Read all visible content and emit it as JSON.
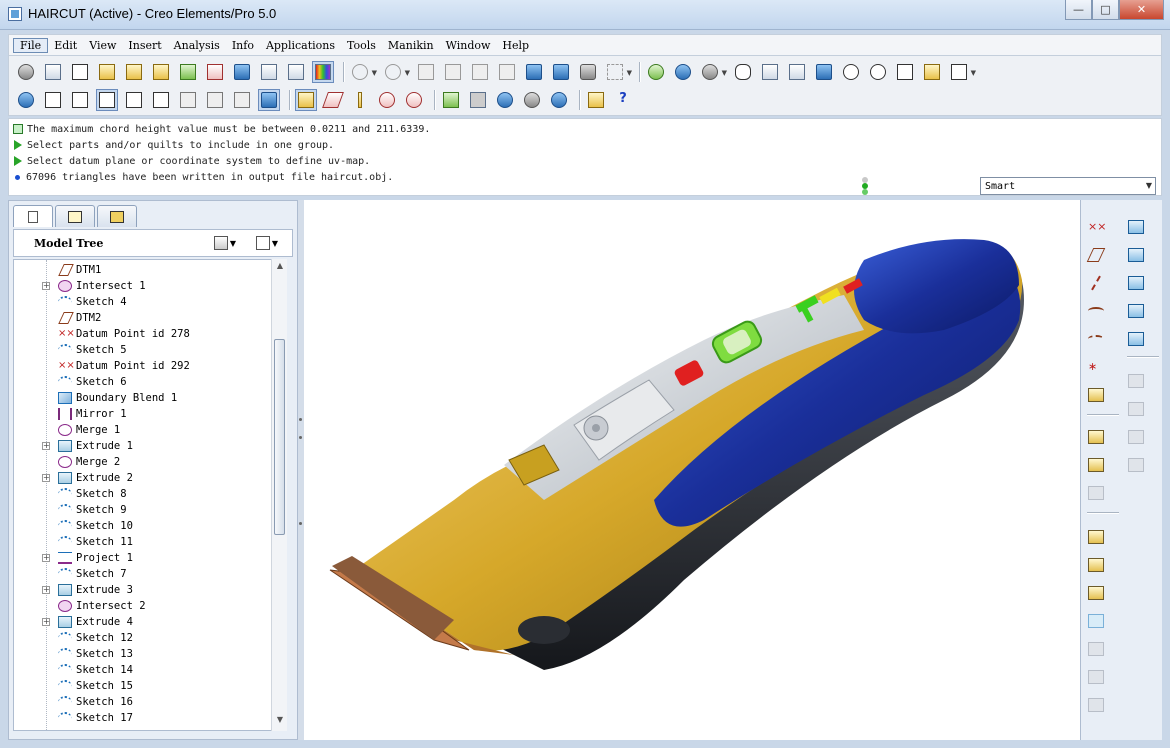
{
  "window": {
    "title": "HAIRCUT (Active) - Creo Elements/Pro 5.0",
    "buttons": [
      "minimize",
      "maximize",
      "close"
    ]
  },
  "menu": [
    "File",
    "Edit",
    "View",
    "Insert",
    "Analysis",
    "Info",
    "Applications",
    "Tools",
    "Manikin",
    "Window",
    "Help"
  ],
  "messages": [
    {
      "icon": "info-doc-icon",
      "text": "The maximum chord height value must be between 0.0211 and 211.6339."
    },
    {
      "icon": "prompt-arrow-icon",
      "text": "Select parts and/or quilts to include in one group."
    },
    {
      "icon": "prompt-arrow-icon",
      "text": "Select datum plane or coordinate system to define uv-map."
    },
    {
      "icon": "bullet-icon",
      "text": "67096 triangles have been written in output file haircut.obj."
    }
  ],
  "filter": {
    "value": "Smart"
  },
  "navigator": {
    "tabs": [
      "model-tree-tab-icon",
      "layers-tab-icon",
      "favorites-tab-icon"
    ],
    "header": "Model Tree"
  },
  "model_tree": [
    {
      "label": "DTM1",
      "type": "datum",
      "expandable": false
    },
    {
      "label": "Intersect 1",
      "type": "intersect",
      "expandable": true
    },
    {
      "label": "Sketch 4",
      "type": "sketch",
      "expandable": false
    },
    {
      "label": "DTM2",
      "type": "datum",
      "expandable": false
    },
    {
      "label": "Datum Point id 278",
      "type": "point",
      "expandable": false
    },
    {
      "label": "Sketch 5",
      "type": "sketch",
      "expandable": false
    },
    {
      "label": "Datum Point id 292",
      "type": "point",
      "expandable": false
    },
    {
      "label": "Sketch 6",
      "type": "sketch",
      "expandable": false
    },
    {
      "label": "Boundary Blend 1",
      "type": "blend",
      "expandable": false
    },
    {
      "label": "Mirror 1",
      "type": "mirror",
      "expandable": false
    },
    {
      "label": "Merge 1",
      "type": "merge",
      "expandable": false
    },
    {
      "label": "Extrude 1",
      "type": "extrude",
      "expandable": true
    },
    {
      "label": "Merge 2",
      "type": "merge",
      "expandable": false
    },
    {
      "label": "Extrude 2",
      "type": "extrude",
      "expandable": true
    },
    {
      "label": "Sketch 8",
      "type": "sketch",
      "expandable": false
    },
    {
      "label": "Sketch 9",
      "type": "sketch",
      "expandable": false
    },
    {
      "label": "Sketch 10",
      "type": "sketch",
      "expandable": false
    },
    {
      "label": "Sketch 11",
      "type": "sketch",
      "expandable": false
    },
    {
      "label": "Project 1",
      "type": "project",
      "expandable": true
    },
    {
      "label": "Sketch 7",
      "type": "sketch",
      "expandable": false
    },
    {
      "label": "Extrude 3",
      "type": "extrude",
      "expandable": true
    },
    {
      "label": "Intersect 2",
      "type": "intersect",
      "expandable": false
    },
    {
      "label": "Extrude 4",
      "type": "extrude",
      "expandable": true
    },
    {
      "label": "Sketch 12",
      "type": "sketch",
      "expandable": false
    },
    {
      "label": "Sketch 13",
      "type": "sketch",
      "expandable": false
    },
    {
      "label": "Sketch 14",
      "type": "sketch",
      "expandable": false
    },
    {
      "label": "Sketch 15",
      "type": "sketch",
      "expandable": false
    },
    {
      "label": "Sketch 16",
      "type": "sketch",
      "expandable": false
    },
    {
      "label": "Sketch 17",
      "type": "sketch",
      "expandable": false
    }
  ],
  "colors": {
    "body_blue": "#1f3fa8",
    "accent_gold": "#d6a82a",
    "housing_black": "#2a2d33",
    "window_frame": "#c9d7e8"
  }
}
